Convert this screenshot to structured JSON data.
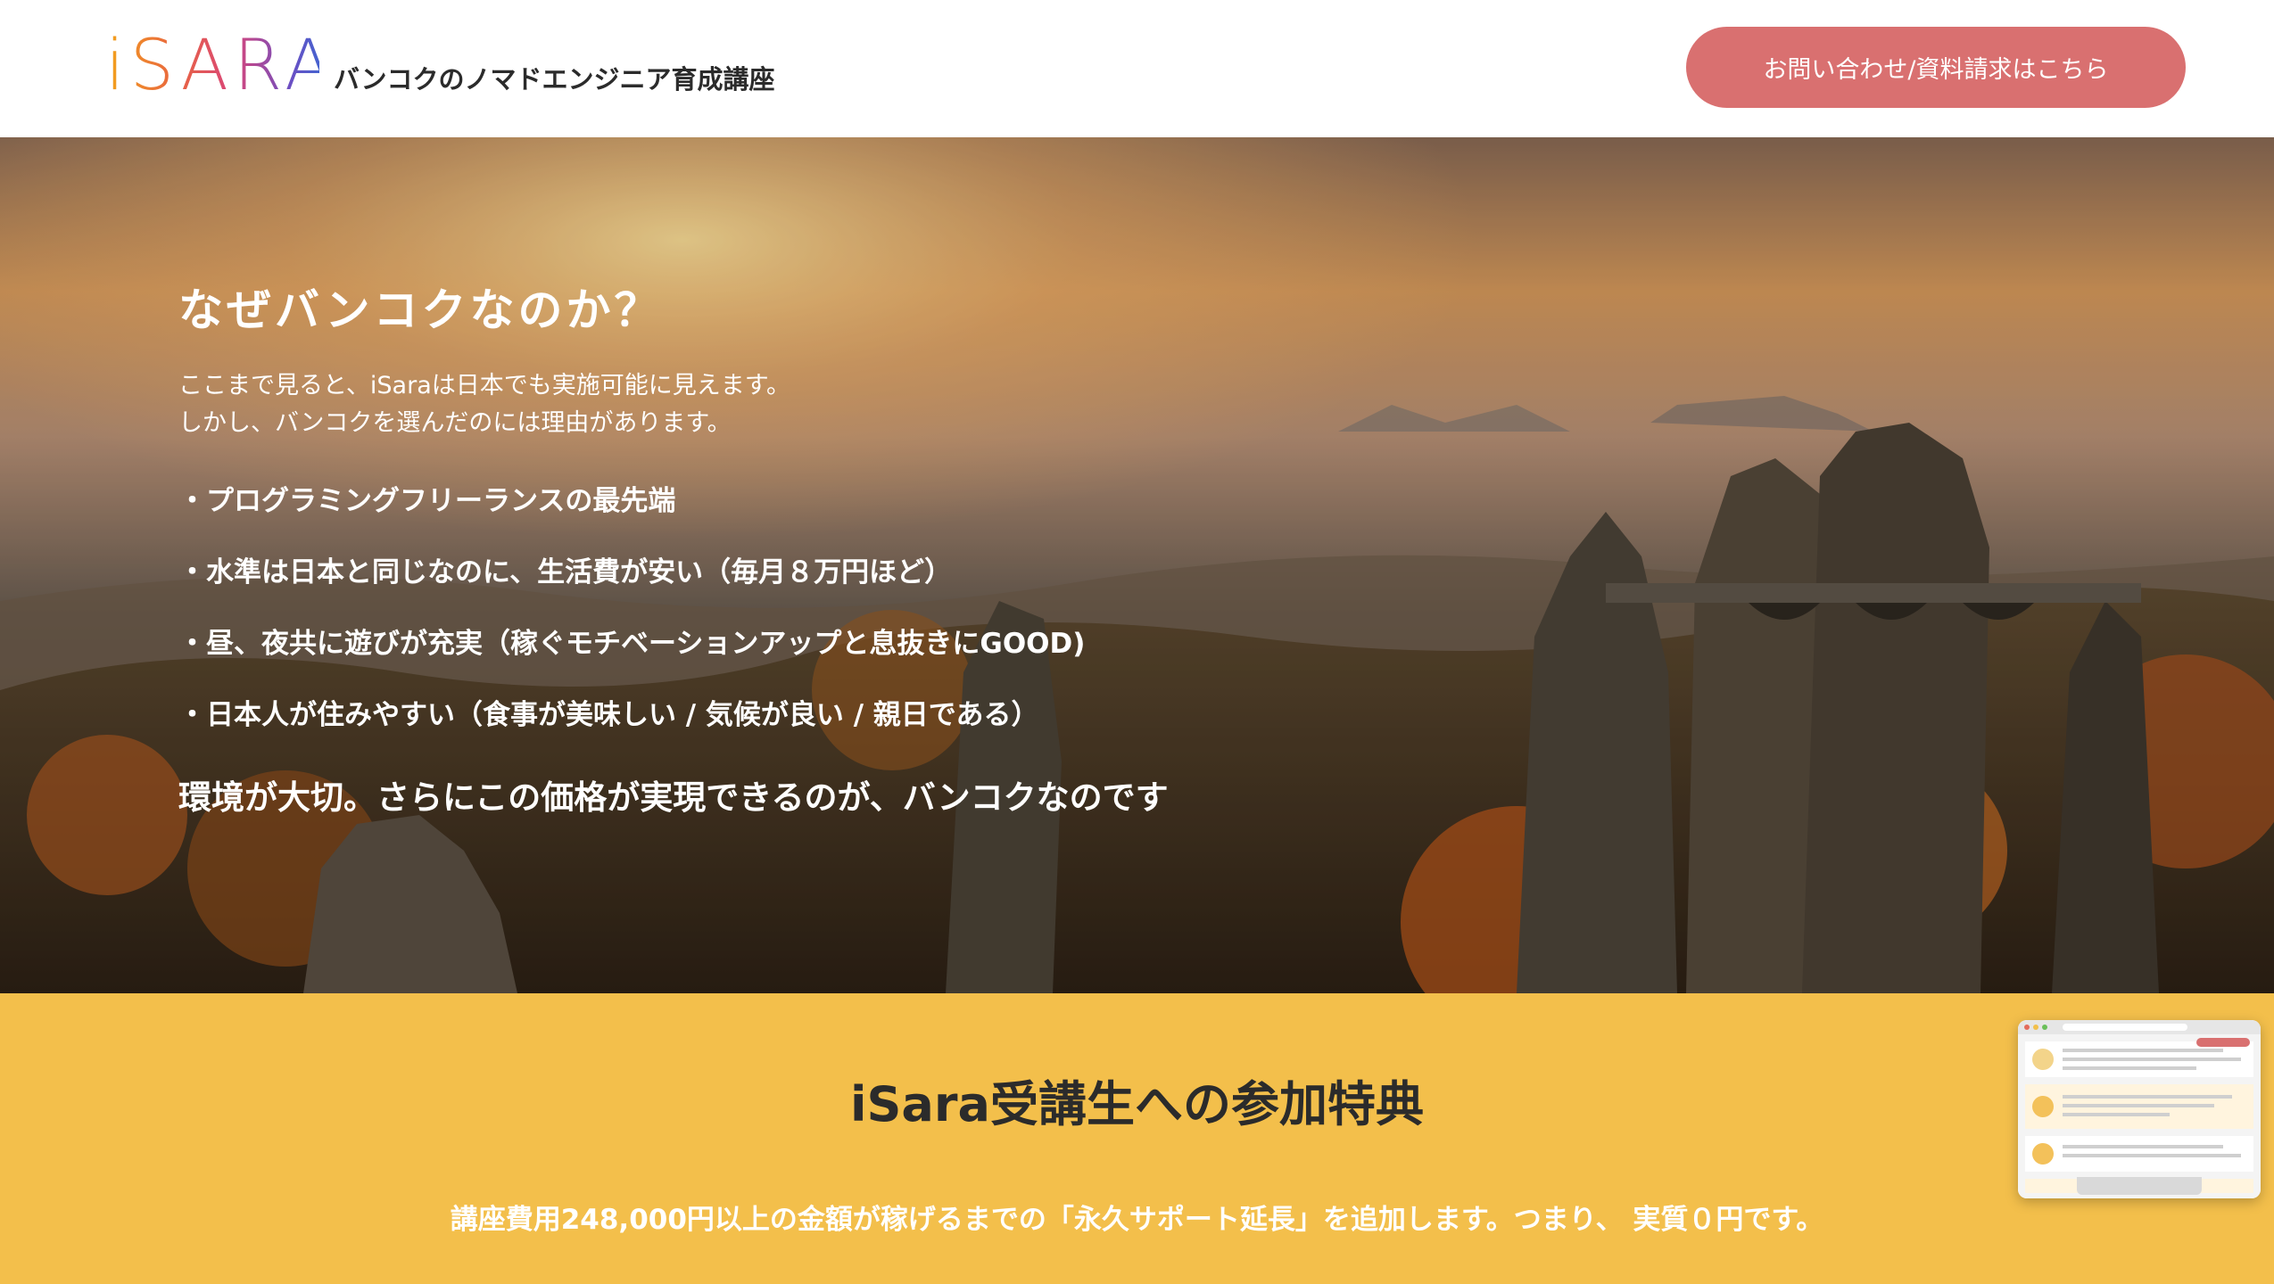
{
  "header": {
    "logo_text": "iSARA",
    "tagline": "バンコクのノマドエンジニア育成講座",
    "cta_label": "お問い合わせ/資料請求はこちら"
  },
  "hero": {
    "title": "なぜバンコクなのか？",
    "intro_line1": "ここまで見ると、iSaraは日本でも実施可能に見えます。",
    "intro_line2": "しかし、バンコクを選んだのには理由があります。",
    "points": [
      "・プログラミングフリーランスの最先端",
      "・水準は日本と同じなのに、生活費が安い（毎月８万円ほど）",
      "・昼、夜共に遊びが充実（稼ぐモチベーションアップと息抜きにGOOD)",
      "・日本人が住みやすい（食事が美味しい / 気候が良い / 親日である）"
    ],
    "closing": "環境が大切。さらにこの価格が実現できるのが、バンコクなのです"
  },
  "benefits": {
    "title": "iSara受講生への参加特典",
    "text": "講座費用248,000円以上の金額が稼げるまでの「永久サポート延長」を追加します。つまり、 実質０円です。"
  },
  "colors": {
    "cta": "#d97070",
    "benefits_bg": "#f3bf4b",
    "text_dark": "#2b2b2b"
  }
}
